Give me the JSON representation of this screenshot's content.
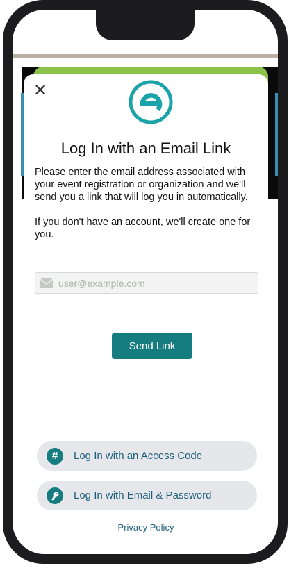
{
  "modal": {
    "close_symbol": "✕",
    "title": "Log In with an Email Link",
    "description_1": "Please enter the email address associated with your event registration or organization and we'll send you a link that will log you in automatically.",
    "description_2": "If you don't have an account, we'll create one for you.",
    "email": {
      "value": "",
      "placeholder": "user@example.com"
    },
    "send_label": "Send Link",
    "access_code_label": "Log In with an Access Code",
    "access_code_icon_glyph": "#",
    "password_label": "Log In with Email & Password",
    "privacy_label": "Privacy Policy"
  },
  "icons": {
    "logo": "circled-e-logo-icon",
    "close": "close-icon",
    "email": "envelope-icon",
    "access_code": "hash-icon",
    "password": "key-icon"
  },
  "colors": {
    "accent": "#157c80",
    "link": "#1f5f7a",
    "pill_bg": "#e6e7ea",
    "header_bar": "#8bc34a"
  }
}
